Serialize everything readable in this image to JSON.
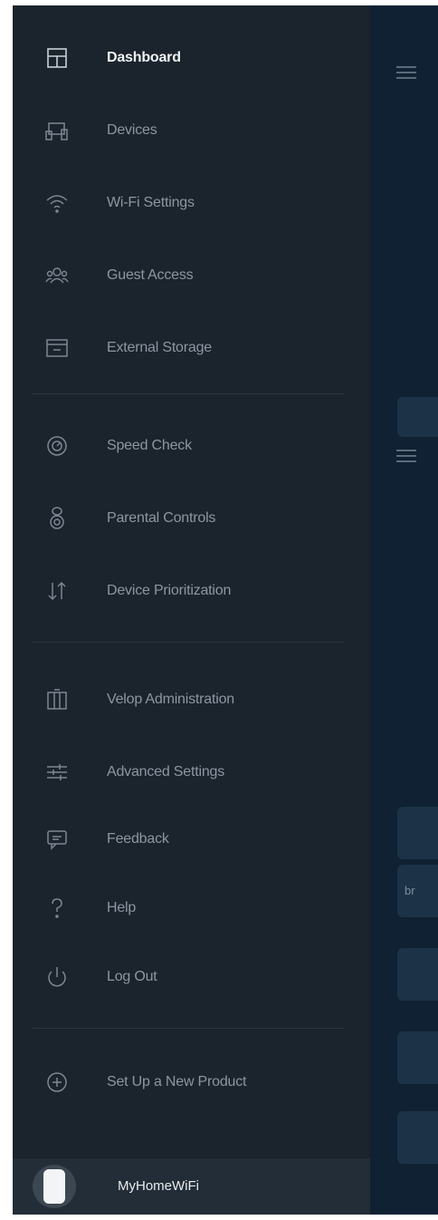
{
  "nav": {
    "section1": [
      {
        "label": "Dashboard",
        "icon": "dashboard-icon",
        "active": true
      },
      {
        "label": "Devices",
        "icon": "devices-icon"
      },
      {
        "label": "Wi-Fi Settings",
        "icon": "wifi-icon"
      },
      {
        "label": "Guest Access",
        "icon": "guest-access-icon"
      },
      {
        "label": "External Storage",
        "icon": "storage-icon"
      }
    ],
    "section2": [
      {
        "label": "Speed Check",
        "icon": "speed-check-icon"
      },
      {
        "label": "Parental Controls",
        "icon": "parental-controls-icon"
      },
      {
        "label": "Device Prioritization",
        "icon": "prioritization-icon"
      }
    ],
    "section3": [
      {
        "label": "Velop Administration",
        "icon": "administration-icon"
      },
      {
        "label": "Advanced Settings",
        "icon": "advanced-settings-icon"
      },
      {
        "label": "Feedback",
        "icon": "feedback-icon"
      },
      {
        "label": "Help",
        "icon": "help-icon"
      },
      {
        "label": "Log Out",
        "icon": "power-icon"
      }
    ],
    "section4": [
      {
        "label": "Set Up a New Product",
        "icon": "add-circle-icon"
      }
    ]
  },
  "footer": {
    "network_name": "MyHomeWiFi",
    "icon": "node-icon"
  },
  "background": {
    "card_text": "br"
  },
  "colors": {
    "drawer_bg": "#1b232c",
    "app_bg": "#102233",
    "label": "#8c97a2",
    "active_label": "#eef2f5",
    "icon": "#7d8894"
  }
}
